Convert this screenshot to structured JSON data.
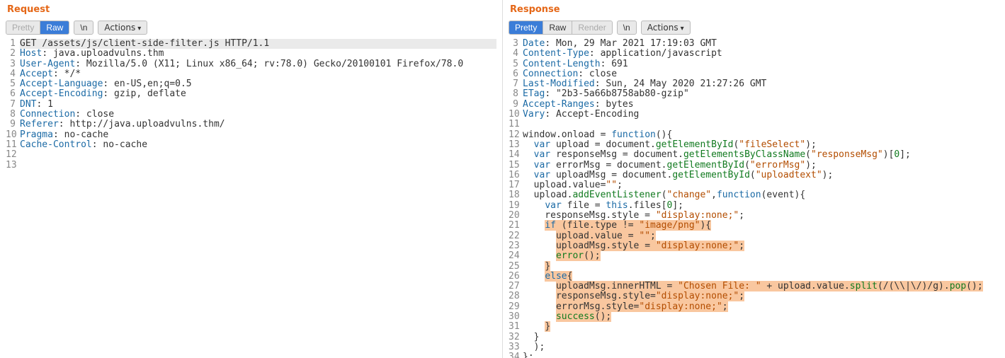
{
  "request": {
    "title": "Request",
    "tabs": {
      "pretty": "Pretty",
      "raw": "Raw",
      "newline": "\\n"
    },
    "actions": "Actions",
    "lines": [
      [
        {
          "c": "t-plain",
          "t": "GET /assets/js/client-side-filter.js HTTP/1.1"
        }
      ],
      [
        {
          "c": "t-key",
          "t": "Host"
        },
        {
          "c": "t-plain",
          "t": ": java.uploadvulns.thm"
        }
      ],
      [
        {
          "c": "t-key",
          "t": "User-Agent"
        },
        {
          "c": "t-plain",
          "t": ": Mozilla/5.0 (X11; Linux x86_64; rv:78.0) Gecko/20100101 Firefox/78.0"
        }
      ],
      [
        {
          "c": "t-key",
          "t": "Accept"
        },
        {
          "c": "t-plain",
          "t": ": */*"
        }
      ],
      [
        {
          "c": "t-key",
          "t": "Accept-Language"
        },
        {
          "c": "t-plain",
          "t": ": en-US,en;q=0.5"
        }
      ],
      [
        {
          "c": "t-key",
          "t": "Accept-Encoding"
        },
        {
          "c": "t-plain",
          "t": ": gzip, deflate"
        }
      ],
      [
        {
          "c": "t-key",
          "t": "DNT"
        },
        {
          "c": "t-plain",
          "t": ": 1"
        }
      ],
      [
        {
          "c": "t-key",
          "t": "Connection"
        },
        {
          "c": "t-plain",
          "t": ": close"
        }
      ],
      [
        {
          "c": "t-key",
          "t": "Referer"
        },
        {
          "c": "t-plain",
          "t": ": http://java.uploadvulns.thm/"
        }
      ],
      [
        {
          "c": "t-key",
          "t": "Pragma"
        },
        {
          "c": "t-plain",
          "t": ": no-cache"
        }
      ],
      [
        {
          "c": "t-key",
          "t": "Cache-Control"
        },
        {
          "c": "t-plain",
          "t": ": no-cache"
        }
      ],
      [],
      []
    ]
  },
  "response": {
    "title": "Response",
    "tabs": {
      "pretty": "Pretty",
      "raw": "Raw",
      "render": "Render",
      "newline": "\\n"
    },
    "actions": "Actions",
    "lines": [
      [
        {
          "c": "t-key",
          "t": "Date"
        },
        {
          "c": "t-plain",
          "t": ": Mon, 29 Mar 2021 17:19:03 GMT"
        }
      ],
      [
        {
          "c": "t-key",
          "t": "Content-Type"
        },
        {
          "c": "t-plain",
          "t": ": application/javascript"
        }
      ],
      [
        {
          "c": "t-key",
          "t": "Content-Length"
        },
        {
          "c": "t-plain",
          "t": ": 691"
        }
      ],
      [
        {
          "c": "t-key",
          "t": "Connection"
        },
        {
          "c": "t-plain",
          "t": ": close"
        }
      ],
      [
        {
          "c": "t-key",
          "t": "Last-Modified"
        },
        {
          "c": "t-plain",
          "t": ": Sun, 24 May 2020 21:27:26 GMT"
        }
      ],
      [
        {
          "c": "t-key",
          "t": "ETag"
        },
        {
          "c": "t-plain",
          "t": ": \"2b3-5a66b8758ab80-gzip\""
        }
      ],
      [
        {
          "c": "t-key",
          "t": "Accept-Ranges"
        },
        {
          "c": "t-plain",
          "t": ": bytes"
        }
      ],
      [
        {
          "c": "t-key",
          "t": "Vary"
        },
        {
          "c": "t-plain",
          "t": ": Accept-Encoding"
        }
      ],
      [],
      [
        {
          "c": "t-plain",
          "t": "window.onload = "
        },
        {
          "c": "t-kw",
          "t": "function"
        },
        {
          "c": "t-plain",
          "t": "(){"
        }
      ],
      [
        {
          "c": "t-plain",
          "t": "  "
        },
        {
          "c": "t-kw",
          "t": "var"
        },
        {
          "c": "t-plain",
          "t": " upload = document."
        },
        {
          "c": "t-func",
          "t": "getElementById"
        },
        {
          "c": "t-plain",
          "t": "("
        },
        {
          "c": "t-str",
          "t": "\"fileSelect\""
        },
        {
          "c": "t-plain",
          "t": ");"
        }
      ],
      [
        {
          "c": "t-plain",
          "t": "  "
        },
        {
          "c": "t-kw",
          "t": "var"
        },
        {
          "c": "t-plain",
          "t": " responseMsg = document."
        },
        {
          "c": "t-func",
          "t": "getElementsByClassName"
        },
        {
          "c": "t-plain",
          "t": "("
        },
        {
          "c": "t-str",
          "t": "\"responseMsg\""
        },
        {
          "c": "t-plain",
          "t": ")["
        },
        {
          "c": "t-num",
          "t": "0"
        },
        {
          "c": "t-plain",
          "t": "];"
        }
      ],
      [
        {
          "c": "t-plain",
          "t": "  "
        },
        {
          "c": "t-kw",
          "t": "var"
        },
        {
          "c": "t-plain",
          "t": " errorMsg = document."
        },
        {
          "c": "t-func",
          "t": "getElementById"
        },
        {
          "c": "t-plain",
          "t": "("
        },
        {
          "c": "t-str",
          "t": "\"errorMsg\""
        },
        {
          "c": "t-plain",
          "t": ");"
        }
      ],
      [
        {
          "c": "t-plain",
          "t": "  "
        },
        {
          "c": "t-kw",
          "t": "var"
        },
        {
          "c": "t-plain",
          "t": " uploadMsg = document."
        },
        {
          "c": "t-func",
          "t": "getElementById"
        },
        {
          "c": "t-plain",
          "t": "("
        },
        {
          "c": "t-str",
          "t": "\"uploadtext\""
        },
        {
          "c": "t-plain",
          "t": ");"
        }
      ],
      [
        {
          "c": "t-plain",
          "t": "  upload.value="
        },
        {
          "c": "t-str",
          "t": "\"\""
        },
        {
          "c": "t-plain",
          "t": ";"
        }
      ],
      [
        {
          "c": "t-plain",
          "t": "  upload."
        },
        {
          "c": "t-func",
          "t": "addEventListener"
        },
        {
          "c": "t-plain",
          "t": "("
        },
        {
          "c": "t-str",
          "t": "\"change\""
        },
        {
          "c": "t-plain",
          "t": ","
        },
        {
          "c": "t-kw",
          "t": "function"
        },
        {
          "c": "t-plain",
          "t": "(event){"
        }
      ],
      [
        {
          "c": "t-plain",
          "t": "    "
        },
        {
          "c": "t-kw",
          "t": "var"
        },
        {
          "c": "t-plain",
          "t": " file = "
        },
        {
          "c": "t-kw",
          "t": "this"
        },
        {
          "c": "t-plain",
          "t": ".files["
        },
        {
          "c": "t-num",
          "t": "0"
        },
        {
          "c": "t-plain",
          "t": "];"
        }
      ],
      [
        {
          "c": "t-plain",
          "t": "    responseMsg.style = "
        },
        {
          "c": "t-str",
          "t": "\"display:none;\""
        },
        {
          "c": "t-plain",
          "t": ";"
        }
      ],
      [
        {
          "c": "t-plain",
          "t": "    "
        },
        {
          "c": "t-kw",
          "t": "if",
          "hl": true
        },
        {
          "c": "t-plain",
          "t": " (file.type != ",
          "hl": true
        },
        {
          "c": "t-str",
          "t": "\"image/png\"",
          "hl": true
        },
        {
          "c": "t-plain",
          "t": "){",
          "hl": true
        }
      ],
      [
        {
          "c": "t-plain",
          "t": "      "
        },
        {
          "c": "t-plain",
          "t": "upload.value = ",
          "hl": true
        },
        {
          "c": "t-str",
          "t": "\"\"",
          "hl": true
        },
        {
          "c": "t-plain",
          "t": ";",
          "hl": true
        }
      ],
      [
        {
          "c": "t-plain",
          "t": "      "
        },
        {
          "c": "t-plain",
          "t": "uploadMsg.style = ",
          "hl": true
        },
        {
          "c": "t-str",
          "t": "\"display:none;\"",
          "hl": true
        },
        {
          "c": "t-plain",
          "t": ";",
          "hl": true
        }
      ],
      [
        {
          "c": "t-plain",
          "t": "      "
        },
        {
          "c": "t-func",
          "t": "error",
          "hl": true
        },
        {
          "c": "t-plain",
          "t": "();",
          "hl": true
        }
      ],
      [
        {
          "c": "t-plain",
          "t": "    "
        },
        {
          "c": "t-plain",
          "t": "}",
          "hl": true
        }
      ],
      [
        {
          "c": "t-plain",
          "t": "    "
        },
        {
          "c": "t-kw",
          "t": "else",
          "hl": true
        },
        {
          "c": "t-plain",
          "t": "{",
          "hl": true
        }
      ],
      [
        {
          "c": "t-plain",
          "t": "      "
        },
        {
          "c": "t-plain",
          "t": "uploadMsg.innerHTML = ",
          "hl": true
        },
        {
          "c": "t-str",
          "t": "\"Chosen File: \"",
          "hl": true
        },
        {
          "c": "t-plain",
          "t": " + upload.value.",
          "hl": true
        },
        {
          "c": "t-func",
          "t": "split",
          "hl": true
        },
        {
          "c": "t-plain",
          "t": "(/(\\\\|\\/)/g).",
          "hl": true
        },
        {
          "c": "t-func",
          "t": "pop",
          "hl": true
        },
        {
          "c": "t-plain",
          "t": "();",
          "hl": true
        }
      ],
      [
        {
          "c": "t-plain",
          "t": "      "
        },
        {
          "c": "t-plain",
          "t": "responseMsg.style=",
          "hl": true
        },
        {
          "c": "t-str",
          "t": "\"display:none;\"",
          "hl": true
        },
        {
          "c": "t-plain",
          "t": ";",
          "hl": true
        }
      ],
      [
        {
          "c": "t-plain",
          "t": "      "
        },
        {
          "c": "t-plain",
          "t": "errorMsg.style=",
          "hl": true
        },
        {
          "c": "t-str",
          "t": "\"display:none;\"",
          "hl": true
        },
        {
          "c": "t-plain",
          "t": ";",
          "hl": true
        }
      ],
      [
        {
          "c": "t-plain",
          "t": "      "
        },
        {
          "c": "t-func",
          "t": "success",
          "hl": true
        },
        {
          "c": "t-plain",
          "t": "();",
          "hl": true
        }
      ],
      [
        {
          "c": "t-plain",
          "t": "    "
        },
        {
          "c": "t-plain",
          "t": "}",
          "hl": true
        }
      ],
      [
        {
          "c": "t-plain",
          "t": "  }"
        }
      ],
      [
        {
          "c": "t-plain",
          "t": "  );"
        }
      ],
      [
        {
          "c": "t-plain",
          "t": "};"
        }
      ]
    ]
  }
}
